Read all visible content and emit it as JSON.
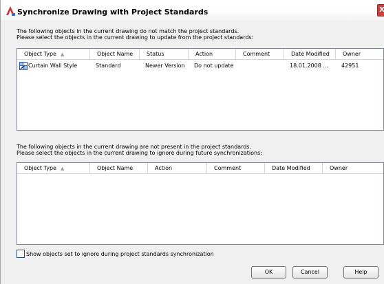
{
  "window": {
    "title": "Synchronize Drawing with Project Standards",
    "close_glyph": "X"
  },
  "section1": {
    "line1": "The following objects in the current drawing do not match the project standards.",
    "line2": "Please select the objects in the current drawing to update from the project standards:",
    "columns": [
      "Object Type",
      "Object Name",
      "Status",
      "Action",
      "Comment",
      "Date Modified",
      "Owner"
    ],
    "rows": [
      {
        "object_type": "Curtain Wall Style",
        "object_name": "Standard",
        "status": "Newer Version",
        "action": "Do not update",
        "comment": "",
        "date_modified": "18.01.2008 ...",
        "owner": "42951"
      }
    ]
  },
  "section2": {
    "line1": "The following objects in the current drawing are not present in the project standards.",
    "line2": "Please select the objects in the current drawing to ignore during future synchronizations:",
    "columns": [
      "Object Type",
      "Object Name",
      "Action",
      "Comment",
      "Date Modified",
      "Owner"
    ]
  },
  "checkbox": {
    "label": "Show objects set to ignore during project standards synchronization",
    "checked": false
  },
  "buttons": {
    "ok": "OK",
    "cancel": "Cancel",
    "help": "Help"
  },
  "icons": {
    "app": "autocad-architecture-icon",
    "row": "curtain-wall-style-icon",
    "sort": "sort-ascending-icon"
  }
}
